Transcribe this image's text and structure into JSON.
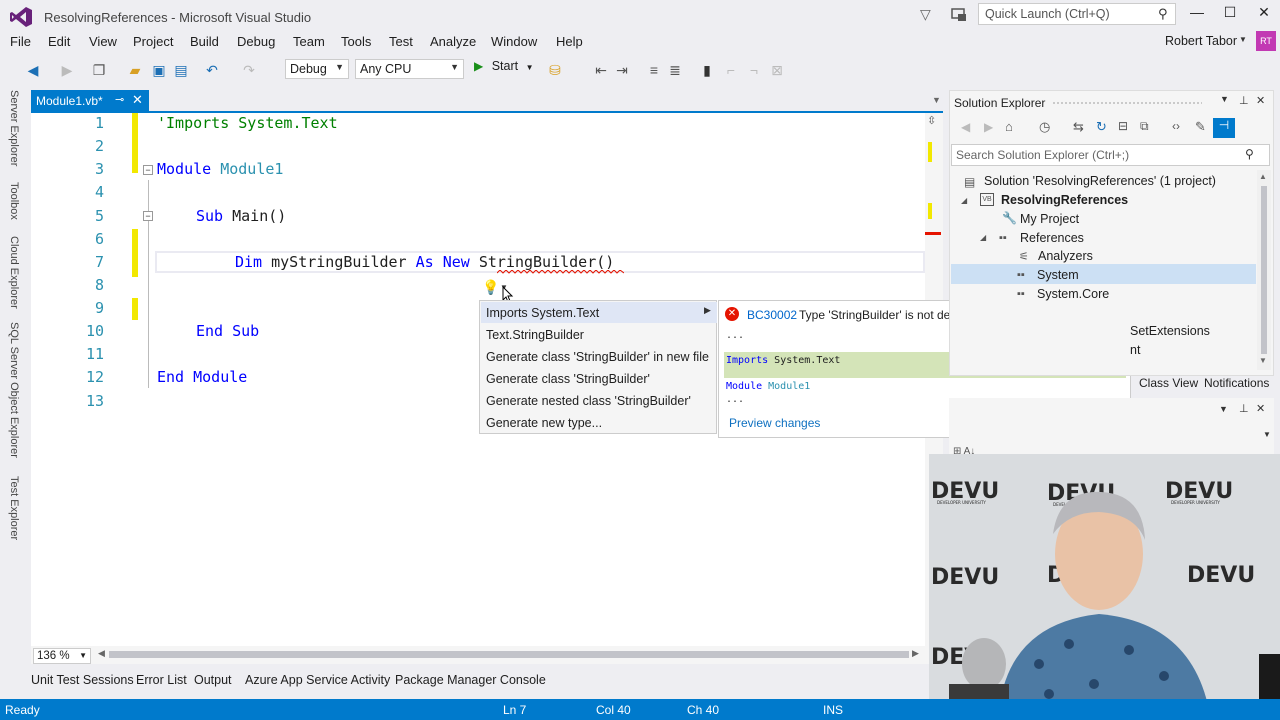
{
  "window": {
    "title": "ResolvingReferences - Microsoft Visual Studio",
    "quick_launch_placeholder": "Quick Launch (Ctrl+Q)",
    "minimize": "—",
    "maximize": "☐",
    "close": "✕"
  },
  "menu": [
    "File",
    "Edit",
    "View",
    "Project",
    "Build",
    "Debug",
    "Team",
    "Tools",
    "Test",
    "Analyze",
    "Window",
    "Help"
  ],
  "user": {
    "name": "Robert Tabor",
    "initials": "RT"
  },
  "toolbar": {
    "config": "Debug",
    "platform": "Any CPU",
    "start_label": "Start"
  },
  "left_tabs": [
    "Server Explorer",
    "Toolbox",
    "Cloud Explorer",
    "SQL Server Object Explorer",
    "Test Explorer"
  ],
  "document_tab": {
    "label": "Module1.vb*"
  },
  "editor": {
    "line_numbers": [
      "1",
      "2",
      "3",
      "4",
      "5",
      "6",
      "7",
      "8",
      "9",
      "10",
      "11",
      "12",
      "13"
    ],
    "line1": "'Imports System.Text",
    "module_kw": "Module",
    "module_name": "Module1",
    "sub_kw": "Sub",
    "sub_name": "Main()",
    "dim_kw": "Dim",
    "var_name": "myStringBuilder",
    "as_kw": "As",
    "new_kw": "New",
    "type_name": "StringBuilder",
    "type_paren": "()",
    "end_sub": "End Sub",
    "end_module": "End Module",
    "zoom": "136 %"
  },
  "quick_actions": {
    "items": [
      "Imports System.Text",
      "Text.StringBuilder",
      "Generate class 'StringBuilder' in new file",
      "Generate class 'StringBuilder'",
      "Generate nested class 'StringBuilder'",
      "Generate new type..."
    ]
  },
  "preview": {
    "error_code": "BC30002",
    "error_message": "Type 'StringBuilder' is not defined.",
    "ellipsis1": "...",
    "import_kw": "Imports",
    "import_ns": " System.Text",
    "module_kw": "Module",
    "module_name": " Module1",
    "ellipsis2": "...",
    "link": "Preview changes"
  },
  "solution_explorer": {
    "title": "Solution Explorer",
    "search_placeholder": "Search Solution Explorer (Ctrl+;)",
    "tree": {
      "solution": "Solution 'ResolvingReferences' (1 project)",
      "project": "ResolvingReferences",
      "my_project": "My Project",
      "references": "References",
      "analyzers": "Analyzers",
      "system": "System",
      "system_core": "System.Core",
      "partial1": "SetExtensions",
      "partial2": "nt"
    },
    "tabs": [
      "Class View",
      "Notifications"
    ]
  },
  "bottom_tabs": [
    "Unit Test Sessions",
    "Error List",
    "Output",
    "Azure App Service Activity",
    "Package Manager Console"
  ],
  "status": {
    "ready": "Ready",
    "line": "Ln 7",
    "col": "Col 40",
    "ch": "Ch 40",
    "mode": "INS"
  },
  "webcam": {
    "brand": "DEVU",
    "tagline": "DEVELOPER UNIVERSITY"
  },
  "colors": {
    "accent": "#007acc",
    "keyword": "#0000ff",
    "comment": "#008000",
    "type": "#2b91af",
    "error": "#e51400"
  }
}
